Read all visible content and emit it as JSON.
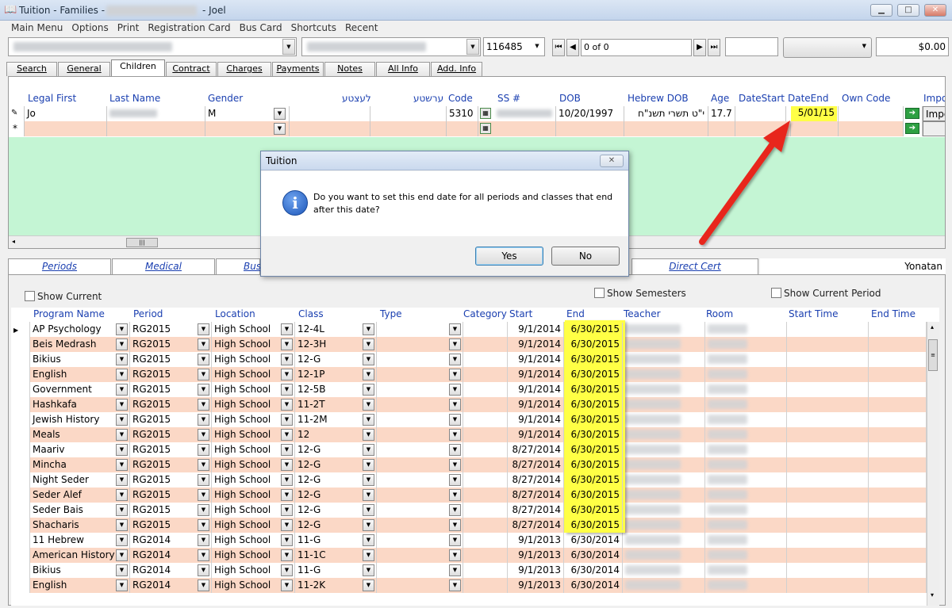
{
  "window": {
    "title_prefix": "Tuition - Families -",
    "title_suffix": "- Joel",
    "minimize": "▁",
    "maximize": "□",
    "close": "✕"
  },
  "menu": [
    "Main Menu",
    "Options",
    "Print",
    "Registration Card",
    "Bus Card",
    "Shortcuts",
    "Recent"
  ],
  "toolbar": {
    "family_id": "116485",
    "record_nav": "0 of 0",
    "balance": "$0.00"
  },
  "tabs": [
    "Search",
    "General Info",
    "Children",
    "Contract",
    "Charges",
    "Payments",
    "Notes",
    "All Info",
    "Add. Info"
  ],
  "child_grid": {
    "headers": [
      "Legal First",
      "Last Name",
      "Gender",
      "לעצטע",
      "ערשטע",
      "Code",
      "SS #",
      "DOB",
      "Hebrew DOB",
      "Age",
      "DateStart",
      "DateEnd",
      "Own Code",
      "Impo"
    ],
    "row": {
      "first": "Jo",
      "gender": "M",
      "code": "5310",
      "dob": "10/20/1997",
      "hebrew_dob": "י\"ט תשרי תשנ\"ח",
      "age": "17.7",
      "date_end": "5/01/15",
      "impo": "Impo"
    },
    "new_row_marker": "*"
  },
  "lower_tabs": [
    "Periods",
    "Medical",
    "Bus",
    "Direct Cert"
  ],
  "student_name": "Yonatan",
  "options": {
    "show_current": "Show Current",
    "show_semesters": "Show Semesters",
    "show_current_period": "Show Current Period"
  },
  "program_grid": {
    "headers": [
      "Program Name",
      "Period",
      "Location",
      "Class",
      "Type",
      "Category",
      "Start",
      "End",
      "Teacher",
      "Room",
      "Start Time",
      "End Time"
    ],
    "rows": [
      {
        "program": "AP Psychology",
        "period": "RG2015",
        "location": "High School",
        "class": "12-4L",
        "start": "9/1/2014",
        "end": "6/30/2015"
      },
      {
        "program": "Beis Medrash",
        "period": "RG2015",
        "location": "High School",
        "class": "12-3H",
        "start": "9/1/2014",
        "end": "6/30/2015"
      },
      {
        "program": "Bikius",
        "period": "RG2015",
        "location": "High School",
        "class": "12-G",
        "start": "9/1/2014",
        "end": "6/30/2015"
      },
      {
        "program": "English",
        "period": "RG2015",
        "location": "High School",
        "class": "12-1P",
        "start": "9/1/2014",
        "end": "6/30/2015"
      },
      {
        "program": "Government",
        "period": "RG2015",
        "location": "High School",
        "class": "12-5B",
        "start": "9/1/2014",
        "end": "6/30/2015"
      },
      {
        "program": "Hashkafa",
        "period": "RG2015",
        "location": "High School",
        "class": "11-2T",
        "start": "9/1/2014",
        "end": "6/30/2015"
      },
      {
        "program": "Jewish History",
        "period": "RG2015",
        "location": "High School",
        "class": "11-2M",
        "start": "9/1/2014",
        "end": "6/30/2015"
      },
      {
        "program": "Meals",
        "period": "RG2015",
        "location": "High School",
        "class": "12",
        "start": "9/1/2014",
        "end": "6/30/2015"
      },
      {
        "program": "Maariv",
        "period": "RG2015",
        "location": "High School",
        "class": "12-G",
        "start": "8/27/2014",
        "end": "6/30/2015"
      },
      {
        "program": "Mincha",
        "period": "RG2015",
        "location": "High School",
        "class": "12-G",
        "start": "8/27/2014",
        "end": "6/30/2015"
      },
      {
        "program": "Night Seder",
        "period": "RG2015",
        "location": "High School",
        "class": "12-G",
        "start": "8/27/2014",
        "end": "6/30/2015"
      },
      {
        "program": "Seder Alef",
        "period": "RG2015",
        "location": "High School",
        "class": "12-G",
        "start": "8/27/2014",
        "end": "6/30/2015"
      },
      {
        "program": "Seder Bais",
        "period": "RG2015",
        "location": "High School",
        "class": "12-G",
        "start": "8/27/2014",
        "end": "6/30/2015"
      },
      {
        "program": "Shacharis",
        "period": "RG2015",
        "location": "High School",
        "class": "12-G",
        "start": "8/27/2014",
        "end": "6/30/2015"
      },
      {
        "program": "11 Hebrew",
        "period": "RG2014",
        "location": "High School",
        "class": "11-G",
        "start": "9/1/2013",
        "end": "6/30/2014"
      },
      {
        "program": "American History",
        "period": "RG2014",
        "location": "High School",
        "class": "11-1C",
        "start": "9/1/2013",
        "end": "6/30/2014"
      },
      {
        "program": "Bikius",
        "period": "RG2014",
        "location": "High School",
        "class": "11-G",
        "start": "9/1/2013",
        "end": "6/30/2014"
      },
      {
        "program": "English",
        "period": "RG2014",
        "location": "High School",
        "class": "11-2K",
        "start": "9/1/2013",
        "end": "6/30/2014"
      }
    ]
  },
  "dialog": {
    "title": "Tuition",
    "message": "Do you want to set this end date for all periods and classes that end after this date?",
    "yes": "Yes",
    "no": "No",
    "close": "✕"
  },
  "colors": {
    "highlight": "#ffff45",
    "arrow": "#e8281e",
    "alt_row": "#fbd8c6",
    "green_area": "#c4f5d4",
    "header_blue": "#1a3fb0"
  }
}
